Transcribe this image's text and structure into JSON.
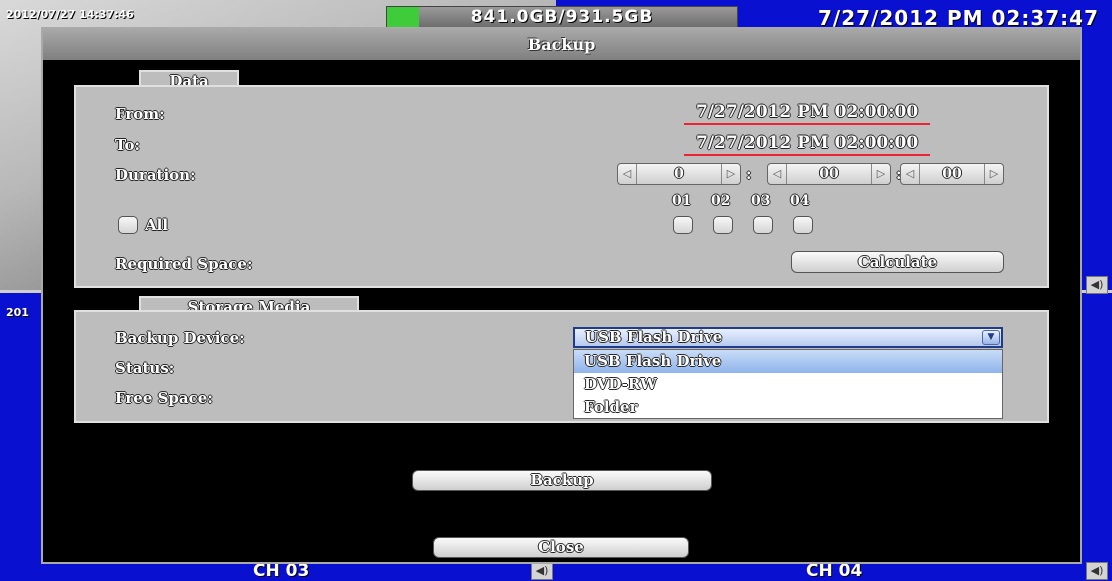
{
  "background": {
    "timestamp_top": "2012/07/27 14:37:46",
    "timestamp_bottom": "201",
    "hdd_usage": "841.0GB/931.5GB",
    "hdd_fill_fraction": 0.09,
    "clock": "7/27/2012 PM 02:37:47",
    "channels": [
      "CH 03",
      "CH 04"
    ],
    "speaker_icon": "speaker-icon"
  },
  "dialog": {
    "title": "Backup",
    "data_section": {
      "tab_label": "Data",
      "from_label": "From:",
      "from_value": "7/27/2012 PM 02:00:00",
      "to_label": "To:",
      "to_value": "7/27/2012 PM 02:00:00",
      "duration_label": "Duration:",
      "duration_hours": "0",
      "duration_minutes": "00",
      "duration_seconds": "00",
      "separator": ":",
      "channel_headers": [
        "01",
        "02",
        "03",
        "04"
      ],
      "all_label": "All",
      "required_space_label": "Required Space:",
      "calculate_button": "Calculate"
    },
    "storage_section": {
      "tab_label": "Storage Media",
      "backup_device_label": "Backup Device:",
      "status_label": "Status:",
      "free_space_label": "Free Space:",
      "selected_device": "USB Flash Drive",
      "device_options": [
        "USB Flash Drive",
        "DVD-RW",
        "Folder"
      ]
    },
    "backup_button": "Backup",
    "close_button": "Close"
  },
  "colors": {
    "panel_blue": "#0a10d0",
    "dialog_bg": "#000000",
    "group_bg": "#bdbdbd",
    "hdd_fill": "#3ecc3a",
    "date_underline": "#e22233"
  }
}
